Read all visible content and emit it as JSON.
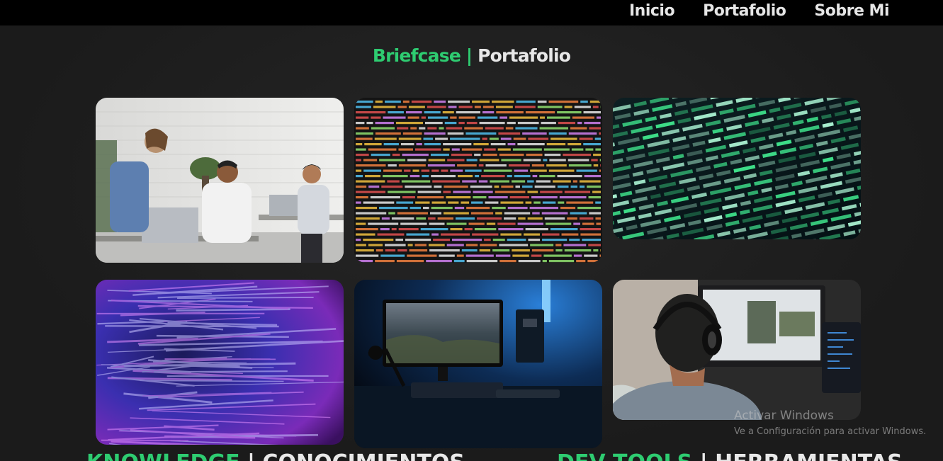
{
  "nav": {
    "items": [
      "Inicio",
      "Portafolio",
      "Sobre Mi"
    ]
  },
  "portfolio": {
    "title_en": "Briefcase",
    "separator": " | ",
    "title_es": "Portafolio",
    "images": [
      {
        "alt": "team working on laptops in office"
      },
      {
        "alt": "colored source code text"
      },
      {
        "alt": "green matrix numbers on screen"
      },
      {
        "alt": "purple blue blurred code"
      },
      {
        "alt": "desk setup with monitor in blue light"
      },
      {
        "alt": "person with headphones at computer"
      }
    ]
  },
  "sections": {
    "knowledge_en": "KNOWLEDGE",
    "knowledge_sep": " | ",
    "knowledge_es": "CONOCIMIENTOS",
    "tools_en": "DEV TOOLS",
    "tools_sep": " | ",
    "tools_es": "HERRAMIENTAS"
  },
  "watermark": {
    "title": "Activar Windows",
    "subtitle": "Ve a Configuración para activar Windows."
  },
  "colors": {
    "accent": "#2ecc71",
    "topbar": "#000000",
    "background": "#1b1b1b"
  }
}
